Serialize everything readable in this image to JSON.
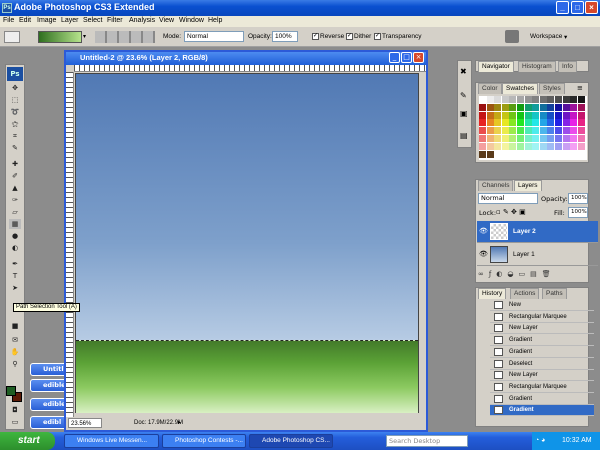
{
  "app": {
    "title": "Adobe Photoshop CS3 Extended"
  },
  "menu": [
    "File",
    "Edit",
    "Image",
    "Layer",
    "Select",
    "Filter",
    "Analysis",
    "View",
    "Window",
    "Help"
  ],
  "options_bar": {
    "mode_label": "Mode:",
    "mode_value": "Normal",
    "opacity_label": "Opacity:",
    "opacity_value": "100%",
    "reverse_label": "Reverse",
    "dither_label": "Dither",
    "transparency_label": "Transparency",
    "workspace_label": "Workspace"
  },
  "document": {
    "title": "Untitled-2 @ 23.6% (Layer 2, RGB/8)",
    "zoom": "23.56%",
    "doc_info": "Doc: 17.9M/22.9M"
  },
  "tooltip": "Path Selection Tool (A)",
  "minimized": [
    "Untitl",
    "edible",
    "edible",
    "edibl"
  ],
  "navigator_tabs": [
    "Navigator",
    "Histogram",
    "Info"
  ],
  "swatches_tabs": [
    "Color",
    "Swatches",
    "Styles"
  ],
  "layers_panel": {
    "tabs": [
      "Channels",
      "Layers"
    ],
    "blend": "Normal",
    "opacity_label": "Opacity:",
    "opacity_value": "100%",
    "lock_label": "Lock:",
    "fill_label": "Fill:",
    "fill_value": "100%",
    "layers": [
      {
        "name": "Layer 2",
        "selected": true
      },
      {
        "name": "Layer 1",
        "selected": false
      }
    ]
  },
  "history_panel": {
    "tabs": [
      "History",
      "Actions",
      "Paths"
    ],
    "items": [
      "New",
      "Rectangular Marquee",
      "New Layer",
      "Gradient",
      "Gradient",
      "Deselect",
      "New Layer",
      "Rectangular Marquee",
      "Gradient",
      "Gradient"
    ]
  },
  "taskbar": {
    "start": "start",
    "items": [
      "Windows Live Messen...",
      "Photoshop Contests -...",
      "Adobe Photoshop CS..."
    ],
    "search_placeholder": "Search Desktop",
    "clock": "10:32 AM"
  },
  "colors": {
    "foreground": "#1e5e23",
    "background": "#5a1a06",
    "selection": "#316ac5"
  }
}
